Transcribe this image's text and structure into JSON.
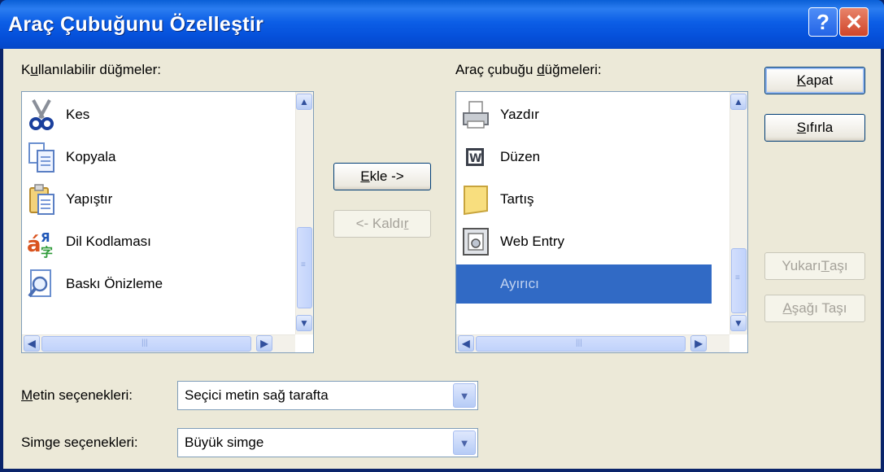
{
  "window": {
    "title": "Araç Çubuğunu Özelleştir",
    "help_glyph": "?",
    "close_glyph": "✕"
  },
  "available": {
    "label_pre": "K",
    "label_u": "u",
    "label_post": "llanılabilir düğmeler:",
    "items": [
      {
        "label": "Kes",
        "icon": "scissors-icon"
      },
      {
        "label": "Kopyala",
        "icon": "copy-icon"
      },
      {
        "label": "Yapıştır",
        "icon": "paste-icon"
      },
      {
        "label": "Dil Kodlaması",
        "icon": "encoding-icon"
      },
      {
        "label": "Baskı Önizleme",
        "icon": "print-preview-icon"
      }
    ]
  },
  "toolbar_buttons": {
    "label_pre": "Araç çubuğu ",
    "label_u": "d",
    "label_post": "üğmeleri:",
    "items": [
      {
        "label": "Yazdır",
        "icon": "printer-icon"
      },
      {
        "label": "Düzen",
        "icon": "word-edit-icon"
      },
      {
        "label": "Tartış",
        "icon": "discuss-icon"
      },
      {
        "label": "Web Entry",
        "icon": "web-entry-icon"
      },
      {
        "label": "Ayırıcı",
        "icon": "",
        "selected": true
      }
    ]
  },
  "buttons": {
    "add_u": "E",
    "add_rest": "kle ->",
    "remove_pre": "<- Kaldı",
    "remove_u": "r",
    "close_u": "K",
    "close_rest": "apat",
    "reset_u": "S",
    "reset_rest": "ıfırla",
    "move_up_pre": "Yukarı ",
    "move_up_u": "T",
    "move_up_post": "aşı",
    "move_down_u": "A",
    "move_down_rest": "şağı Taşı"
  },
  "text_options": {
    "label_u": "M",
    "label_rest": "etin seçenekleri:",
    "value": "Seçici metin sağ tarafta"
  },
  "icon_options": {
    "label_pre": "Sim",
    "label_u": "g",
    "label_post": "e seçenekleri:",
    "value": "Büyük simge"
  },
  "colors": {
    "title_bar": "#0550da",
    "selection": "#316ac5",
    "dialog_bg": "#ece9d8"
  }
}
